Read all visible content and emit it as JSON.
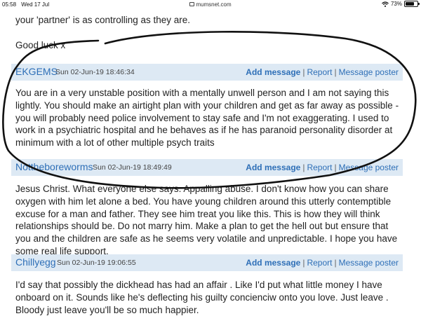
{
  "status_bar": {
    "time": "05:58",
    "date": "Wed 17 Jul",
    "url": "mumsnet.com",
    "battery": "73%",
    "battery_level": 0.73
  },
  "thread": {
    "prev_tail": {
      "line1": "your 'partner' is as controlling as they are.",
      "line2": "Good luck x"
    },
    "posts": [
      {
        "poster": "EKGEMS",
        "date": "Sun 02-Jun-19 18:46:34",
        "body": "You are in a very unstable position with a mentally unwell person and I am not saying this lightly. You should make an airtight plan with your children and get as far away as possible -you will probably need police involvement to stay safe and I'm not exaggerating. I used to work in a psychiatric hospital and he behaves as if he has paranoid personality disorder at minimum with a lot of other multiple psych traits"
      },
      {
        "poster": "Nottheboreworms",
        "date": "Sun 02-Jun-19 18:49:49",
        "body": "Jesus Christ. What everyone else says. Appalling abuse. I don't know how you can share oxygen with him let alone a bed. You have young children around this utterly contemptible excuse for a man and father. They see him treat you like this. This is how they will think relationships should be. Do not marry him. Make a plan to get the hell out but ensure that you and the children are safe as he seems very volatile and unpredictable. I hope you have some real life support."
      },
      {
        "poster": "Chillyegg",
        "date": "Sun 02-Jun-19 19:06:55",
        "body": "I'd say that possibly the dickhead has had an affair . Like I'd put what little money I have onboard on it. Sounds like he's deflecting his guilty concienciw onto you love. Just leave . Bloody just leave you'll be so much happier."
      }
    ],
    "actions": {
      "add_message": "Add message",
      "separator": "|",
      "report": "Report",
      "message_poster": "Message poster"
    }
  },
  "colors": {
    "header_bg": "#dde9f4",
    "link": "#2e6fb7",
    "annotation_ink": "#111111"
  }
}
